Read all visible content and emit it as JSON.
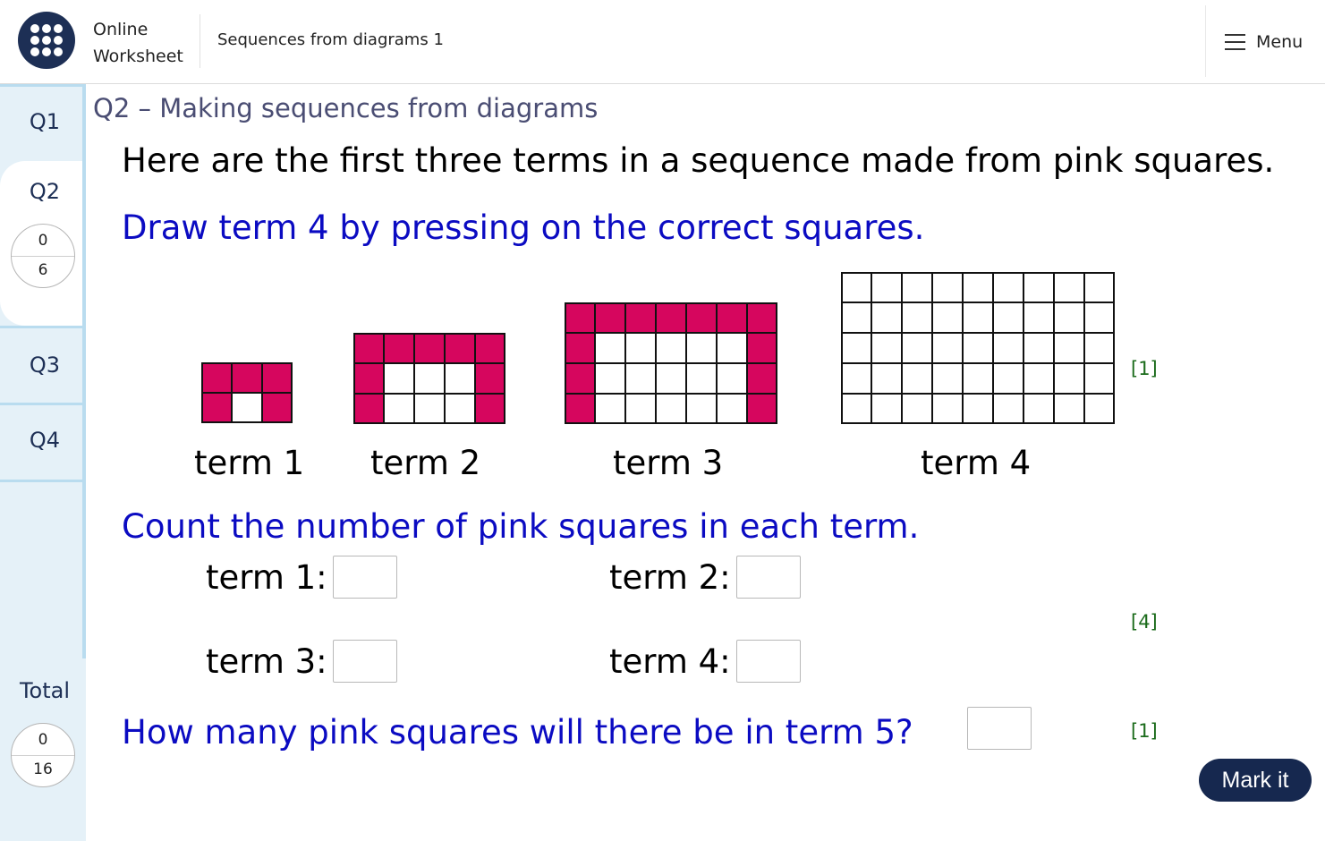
{
  "header": {
    "brand_line1": "Online",
    "brand_line2": "Worksheet",
    "worksheet_title": "Sequences from diagrams 1",
    "menu_label": "Menu",
    "logo_color": "#1d2f55"
  },
  "sidebar": {
    "items": [
      {
        "label": "Q1"
      },
      {
        "label": "Q2",
        "active": true,
        "score": "0",
        "max": "6"
      },
      {
        "label": "Q3"
      },
      {
        "label": "Q4"
      }
    ],
    "total": {
      "label": "Total",
      "score": "0",
      "max": "16"
    }
  },
  "question": {
    "heading": "Q2 – Making sequences from diagrams",
    "intro": "Here are the first three terms in a sequence made from pink squares.",
    "instruction_draw": "Draw term 4 by pressing on the correct squares.",
    "instruction_count": "Count the number of pink squares in each term.",
    "instruction_term5": "How many pink squares will there be in term 5?",
    "marks": {
      "draw": "[1]",
      "count": "[4]",
      "term5": "[1]"
    },
    "pink_color": "#d6065e"
  },
  "terms": [
    {
      "label": "term 1",
      "rows": [
        "111",
        "101"
      ]
    },
    {
      "label": "term 2",
      "rows": [
        "11111",
        "10001",
        "10001"
      ]
    },
    {
      "label": "term 3",
      "rows": [
        "1111111",
        "1000001",
        "1000001",
        "1000001"
      ]
    },
    {
      "label": "term 4",
      "rows": [
        "000000000",
        "000000000",
        "000000000",
        "000000000",
        "000000000"
      ]
    }
  ],
  "answers": {
    "term1_label": "term 1:",
    "term2_label": "term 2:",
    "term3_label": "term 3:",
    "term4_label": "term 4:",
    "term1_value": "",
    "term2_value": "",
    "term3_value": "",
    "term4_value": "",
    "term5_value": ""
  },
  "actions": {
    "mark_label": "Mark it"
  }
}
